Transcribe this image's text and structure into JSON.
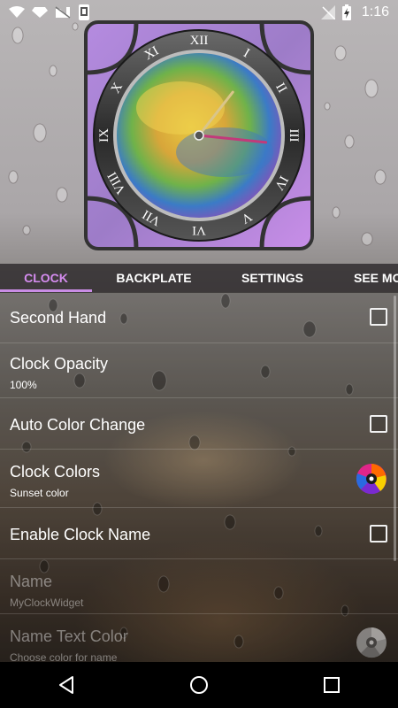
{
  "status_bar": {
    "time": "1:16",
    "icons": [
      "wifi-icon",
      "diamond-signal-icon",
      "no-sim-icon",
      "phone-notification-icon",
      "no-signal-icon",
      "battery-charging-icon"
    ]
  },
  "clock": {
    "numerals": [
      "XII",
      "I",
      "II",
      "III",
      "IV",
      "V",
      "VI",
      "VII",
      "VIII",
      "IX",
      "X",
      "XI"
    ],
    "hour_hand_deg": 38,
    "minute_hand_deg": 96
  },
  "tabs": [
    {
      "label": "CLOCK",
      "active": true
    },
    {
      "label": "BACKPLATE",
      "active": false
    },
    {
      "label": "SETTINGS",
      "active": false
    },
    {
      "label": "SEE MO",
      "active": false
    }
  ],
  "settings": {
    "second_hand": {
      "title": "Second Hand",
      "checked": false
    },
    "clock_opacity": {
      "title": "Clock Opacity",
      "summary": "100%"
    },
    "auto_color_change": {
      "title": "Auto Color Change",
      "checked": false
    },
    "clock_colors": {
      "title": "Clock Colors",
      "summary": "Sunset color"
    },
    "enable_clock_name": {
      "title": "Enable Clock Name",
      "checked": false
    },
    "name": {
      "title": "Name",
      "summary": "MyClockWidget"
    },
    "name_text_color": {
      "title": "Name Text Color",
      "summary": "Choose color for name"
    }
  },
  "colors": {
    "accent": "#c98de6",
    "tab_bar": "#2a2628",
    "nav_bar": "#000000"
  },
  "nav": {
    "back": "back-icon",
    "home": "home-icon",
    "recents": "recents-icon"
  }
}
